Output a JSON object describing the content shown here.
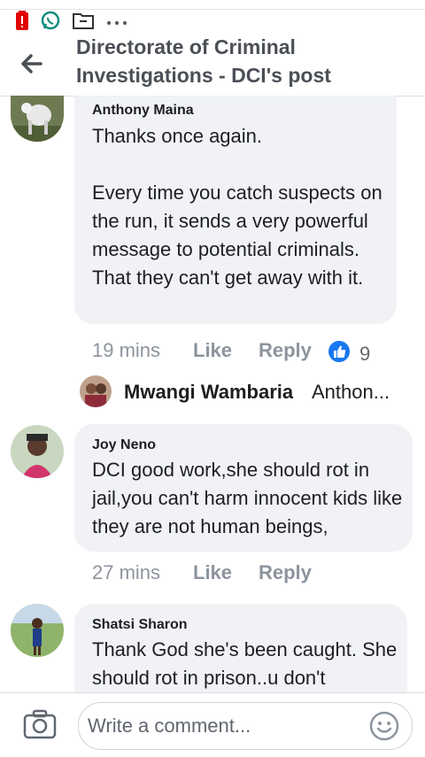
{
  "header": {
    "title": "Directorate of Criminal Investigations - DCI's post"
  },
  "comments": [
    {
      "author": "Anthony Maina",
      "text": "Thanks once again.\n\nEvery time you catch suspects on the run, it sends a very powerful message to potential criminals. That they can't get away with it.",
      "time": "19 mins",
      "like_label": "Like",
      "reply_label": "Reply",
      "reactions": "9",
      "reply_preview": {
        "author": "Mwangi Wambaria",
        "text": "Anthon..."
      }
    },
    {
      "author": "Joy Neno",
      "text": "DCI good work,she should rot in jail,you can't harm innocent kids like they are not human beings,",
      "time": "27 mins",
      "like_label": "Like",
      "reply_label": "Reply"
    },
    {
      "author": "Shatsi Sharon",
      "text": "Thank God she's been caught. She should rot in prison..u don't"
    }
  ],
  "composer": {
    "placeholder": "Write a comment..."
  },
  "colors": {
    "like_blue": "#1877f2",
    "bubble_bg": "#f0f2f5",
    "muted_text": "#8d949e"
  },
  "icons": [
    "battery-alert-icon",
    "whatsapp-icon",
    "folder-icon",
    "more-dots-icon",
    "back-arrow-icon",
    "thumbs-up-icon",
    "camera-icon",
    "emoji-icon"
  ]
}
